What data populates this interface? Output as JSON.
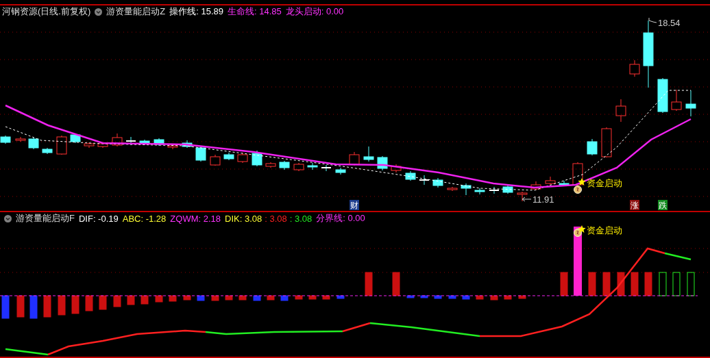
{
  "main_pane": {
    "stock_name": "河钢资源(日线.前复权)",
    "indicator": "游资量能启动Z",
    "values": [
      {
        "text": "操作线: 15.89",
        "color": "#ffffff"
      },
      {
        "text": "生命线: 14.85",
        "color": "#ff33ff"
      },
      {
        "text": "龙头启动: 0.00",
        "color": "#ff33ff"
      }
    ],
    "high_label": "18.54",
    "low_label": "11.91",
    "signal_label": "资金启动",
    "markers": [
      {
        "text": "财",
        "color": "#1c3c8c"
      },
      {
        "text": "涨",
        "color": "#8c1010"
      },
      {
        "text": "跌",
        "color": "#148c20"
      }
    ]
  },
  "sub_pane": {
    "indicator": "游资量能启动F",
    "values": [
      {
        "text": "DIF: -0.19",
        "color": "#ffffff"
      },
      {
        "text": "ABC: -1.28",
        "color": "#ffff33"
      },
      {
        "text": "ZQWM: 2.18",
        "color": "#ff33ff"
      },
      {
        "text": "DIK: 3.08",
        "color": "#ffff33"
      },
      {
        "text": ": 3.08",
        "color": "#ff2020"
      },
      {
        "text": ": 3.08",
        "color": "#22ee22"
      },
      {
        "text": "分界线: 0.00",
        "color": "#ff33ff"
      }
    ],
    "signal_label": "资金启动"
  }
}
